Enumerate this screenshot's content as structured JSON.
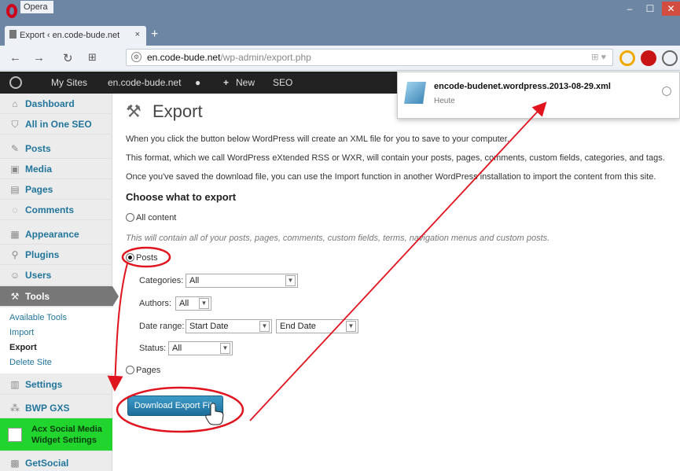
{
  "browser": {
    "app_title": "Opera",
    "tab_title": "Export ‹ en.code-bude.net",
    "url_host": "en.code-bude.net",
    "url_path": "/wp-admin/export.php"
  },
  "adminbar": {
    "my_sites": "My Sites",
    "site": "en.code-bude.net",
    "new": "New",
    "seo": "SEO"
  },
  "sidebar": {
    "items": [
      "Dashboard",
      "All in One SEO",
      "Posts",
      "Media",
      "Pages",
      "Comments",
      "Appearance",
      "Plugins",
      "Users",
      "Tools",
      "Settings",
      "BWP GXS",
      "Acx Social Media Widget Settings",
      "GetSocial"
    ],
    "tools_sub": [
      "Available Tools",
      "Import",
      "Export",
      "Delete Site"
    ]
  },
  "export": {
    "title": "Export",
    "intro1": "When you click the button below WordPress will create an XML file for you to save to your computer.",
    "intro2": "This format, which we call WordPress eXtended RSS or WXR, will contain your posts, pages, comments, custom fields, categories, and tags.",
    "intro3": "Once you've saved the download file, you can use the Import function in another WordPress installation to import the content from this site.",
    "choose": "Choose what to export",
    "all_content": "All content",
    "all_content_desc": "This will contain all of your posts, pages, comments, custom fields, terms, navigation menus and custom posts.",
    "posts": "Posts",
    "categories_label": "Categories:",
    "categories_value": "All",
    "authors_label": "Authors:",
    "authors_value": "All",
    "date_range_label": "Date range:",
    "start_date": "Start Date",
    "end_date": "End Date",
    "status_label": "Status:",
    "status_value": "All",
    "pages": "Pages",
    "download_button": "Download Export File"
  },
  "download_popup": {
    "filename": "encode-budenet.wordpress.2013-08-29.xml",
    "date": "Heute"
  },
  "colors": {
    "annotation": "#e0141e",
    "wp_blue": "#21759b",
    "admin_bar": "#222222"
  }
}
